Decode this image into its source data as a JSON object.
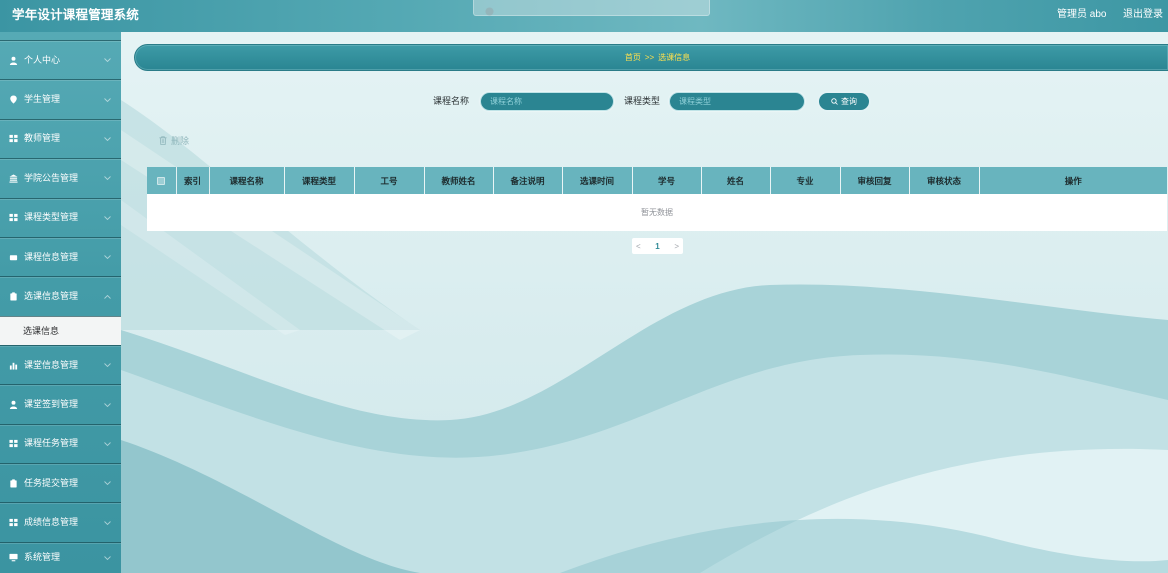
{
  "header": {
    "title": "学年设计课程管理系统",
    "user": "管理员 abo",
    "logout": "退出登录"
  },
  "toast": {
    "icon": "check-circle-icon"
  },
  "sidebar": {
    "items": [
      {
        "label": "个人中心",
        "icon": "user-icon"
      },
      {
        "label": "学生管理",
        "icon": "pin-icon"
      },
      {
        "label": "教师管理",
        "icon": "grid-icon"
      },
      {
        "label": "学院公告管理",
        "icon": "building-icon"
      },
      {
        "label": "课程类型管理",
        "icon": "grid-icon"
      },
      {
        "label": "课程信息管理",
        "icon": "card-icon"
      },
      {
        "label": "选课信息管理",
        "icon": "clipboard-icon",
        "expanded": true,
        "children": [
          {
            "label": "选课信息",
            "active": true
          }
        ]
      },
      {
        "label": "课堂信息管理",
        "icon": "bar-chart-icon"
      },
      {
        "label": "课堂签到管理",
        "icon": "user-icon"
      },
      {
        "label": "课程任务管理",
        "icon": "grid-icon"
      },
      {
        "label": "任务提交管理",
        "icon": "clipboard-icon"
      },
      {
        "label": "成绩信息管理",
        "icon": "grid-icon"
      },
      {
        "label": "系统管理",
        "icon": "monitor-icon"
      }
    ]
  },
  "breadcrumb": {
    "home": "首页",
    "separator": ">>",
    "current": "选课信息"
  },
  "search": {
    "name_label": "课程名称",
    "name_placeholder": "课程名称",
    "type_label": "课程类型",
    "type_placeholder": "课程类型",
    "button": "查询"
  },
  "toolbar": {
    "delete": "删除"
  },
  "table": {
    "columns": [
      "索引",
      "课程名称",
      "课程类型",
      "工号",
      "教师姓名",
      "备注说明",
      "选课时间",
      "学号",
      "姓名",
      "专业",
      "审核回复",
      "审核状态",
      "操作"
    ],
    "rows": [],
    "empty_text": "暂无数据"
  },
  "pagination": {
    "prev": "<",
    "current_page": "1",
    "next": ">"
  },
  "colors": {
    "accent": "#2b8592",
    "header": "#3f98a6",
    "sidebar": "#449ca8",
    "breadcrumb_text": "#ffe14d",
    "table_header": "#68b4be"
  }
}
